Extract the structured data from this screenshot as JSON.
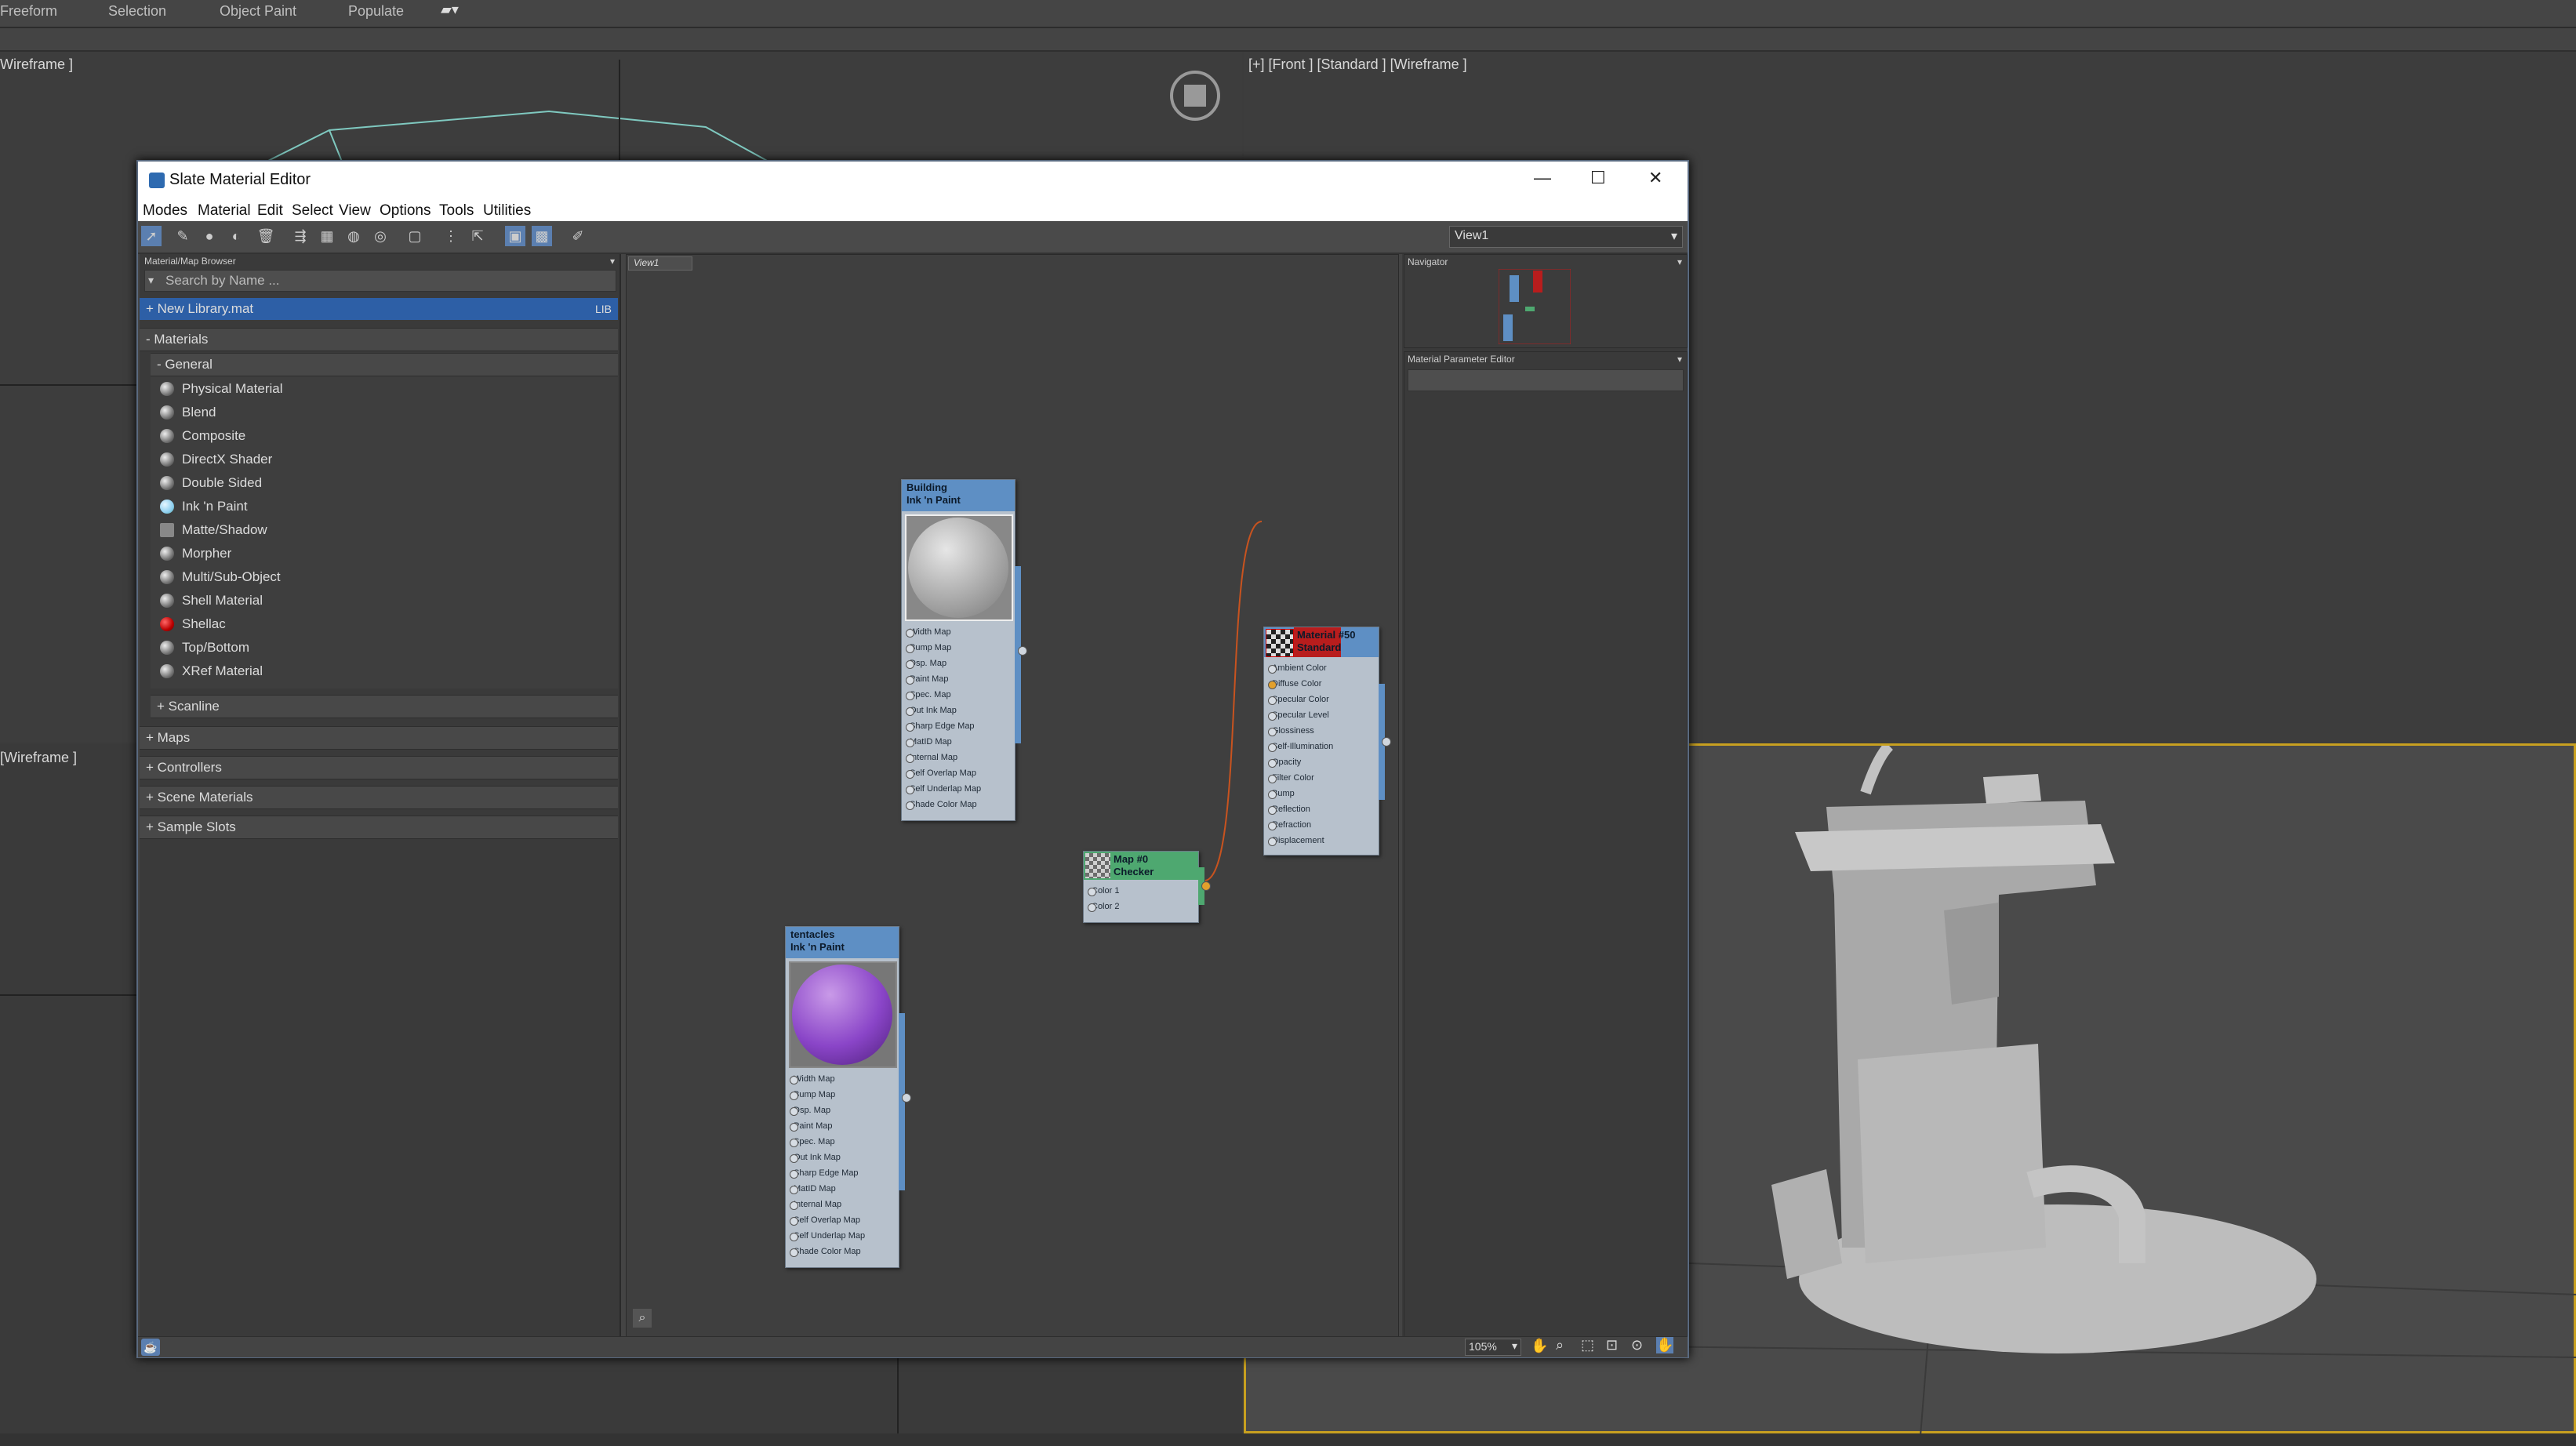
{
  "ribbon": {
    "tabs": [
      "Freeform",
      "Selection",
      "Object Paint",
      "Populate"
    ]
  },
  "viewports": {
    "top_left_label": "Wireframe ]",
    "mid_left_label": "[Wireframe ]",
    "front_label": "[+] [Front ] [Standard ] [Wireframe ]"
  },
  "window": {
    "title": "Slate Material Editor",
    "controls": {
      "minimize": "—",
      "maximize": "☐",
      "close": "✕"
    },
    "menus": [
      "Modes",
      "Material",
      "Edit",
      "Select",
      "View",
      "Options",
      "Tools",
      "Utilities"
    ],
    "view_selector": "View1"
  },
  "browser": {
    "title": "Material/Map Browser",
    "search_placeholder": "Search by Name ...",
    "library": {
      "label": "+ New Library.mat",
      "tag": "LIB"
    },
    "materials_group": "- Materials",
    "general_group": "- General",
    "materials": [
      {
        "label": "Physical Material",
        "icon": "grey-sphere-icon"
      },
      {
        "label": "Blend",
        "icon": "grey-sphere-icon"
      },
      {
        "label": "Composite",
        "icon": "grey-sphere-icon"
      },
      {
        "label": "DirectX Shader",
        "icon": "grey-sphere-icon"
      },
      {
        "label": "Double Sided",
        "icon": "grey-sphere-icon"
      },
      {
        "label": "Ink 'n Paint",
        "icon": "light-blue-sphere-icon"
      },
      {
        "label": "Matte/Shadow",
        "icon": "grey-square-icon"
      },
      {
        "label": "Morpher",
        "icon": "grey-sphere-icon"
      },
      {
        "label": "Multi/Sub-Object",
        "icon": "grey-sphere-icon"
      },
      {
        "label": "Shell Material",
        "icon": "grey-sphere-icon"
      },
      {
        "label": "Shellac",
        "icon": "red-sphere-icon"
      },
      {
        "label": "Top/Bottom",
        "icon": "grey-sphere-icon"
      },
      {
        "label": "XRef Material",
        "icon": "grey-sphere-icon"
      }
    ],
    "scanline_group": "+ Scanline",
    "other_groups": [
      "+ Maps",
      "+ Controllers",
      "+ Scene Materials",
      "+ Sample Slots"
    ]
  },
  "view": {
    "tab": "View1",
    "nodes": {
      "building": {
        "name": "Building",
        "type": "Ink 'n Paint",
        "slots": [
          "Width Map",
          "Bump Map",
          "Dsp. Map",
          "Paint Map",
          "Spec. Map",
          "Out Ink Map",
          "Sharp Edge Map",
          "MatID Map",
          "Internal Map",
          "Self Overlap Map",
          "Self Underlap Map",
          "Shade Color Map"
        ]
      },
      "tentacles": {
        "name": "tentacles",
        "type": "Ink 'n Paint",
        "slots": [
          "Width Map",
          "Bump Map",
          "Dsp. Map",
          "Paint Map",
          "Spec. Map",
          "Out Ink Map",
          "Sharp Edge Map",
          "MatID Map",
          "Internal Map",
          "Self Overlap Map",
          "Self Underlap Map",
          "Shade Color Map"
        ]
      },
      "standard": {
        "name": "Material #50",
        "type": "Standard",
        "slots": [
          "Ambient Color",
          "Diffuse Color",
          "Specular Color",
          "Specular Level",
          "Glossiness",
          "Self-Illumination",
          "Opacity",
          "Filter Color",
          "Bump",
          "Reflection",
          "Refraction",
          "Displacement"
        ]
      },
      "checker": {
        "name": "Map #0",
        "type": "Checker",
        "slots": [
          "Color 1",
          "Color 2"
        ]
      }
    }
  },
  "right_panel": {
    "navigator_title": "Navigator",
    "param_editor_title": "Material Parameter Editor"
  },
  "status": {
    "zoom": "105%"
  },
  "colors": {
    "node_header_blue": "#5e8fc4",
    "node_header_green": "#4ea870",
    "selection_blue": "#2d5fa6",
    "wire_orange": "#c8531f",
    "viewport_border_yellow": "#c8a020"
  }
}
